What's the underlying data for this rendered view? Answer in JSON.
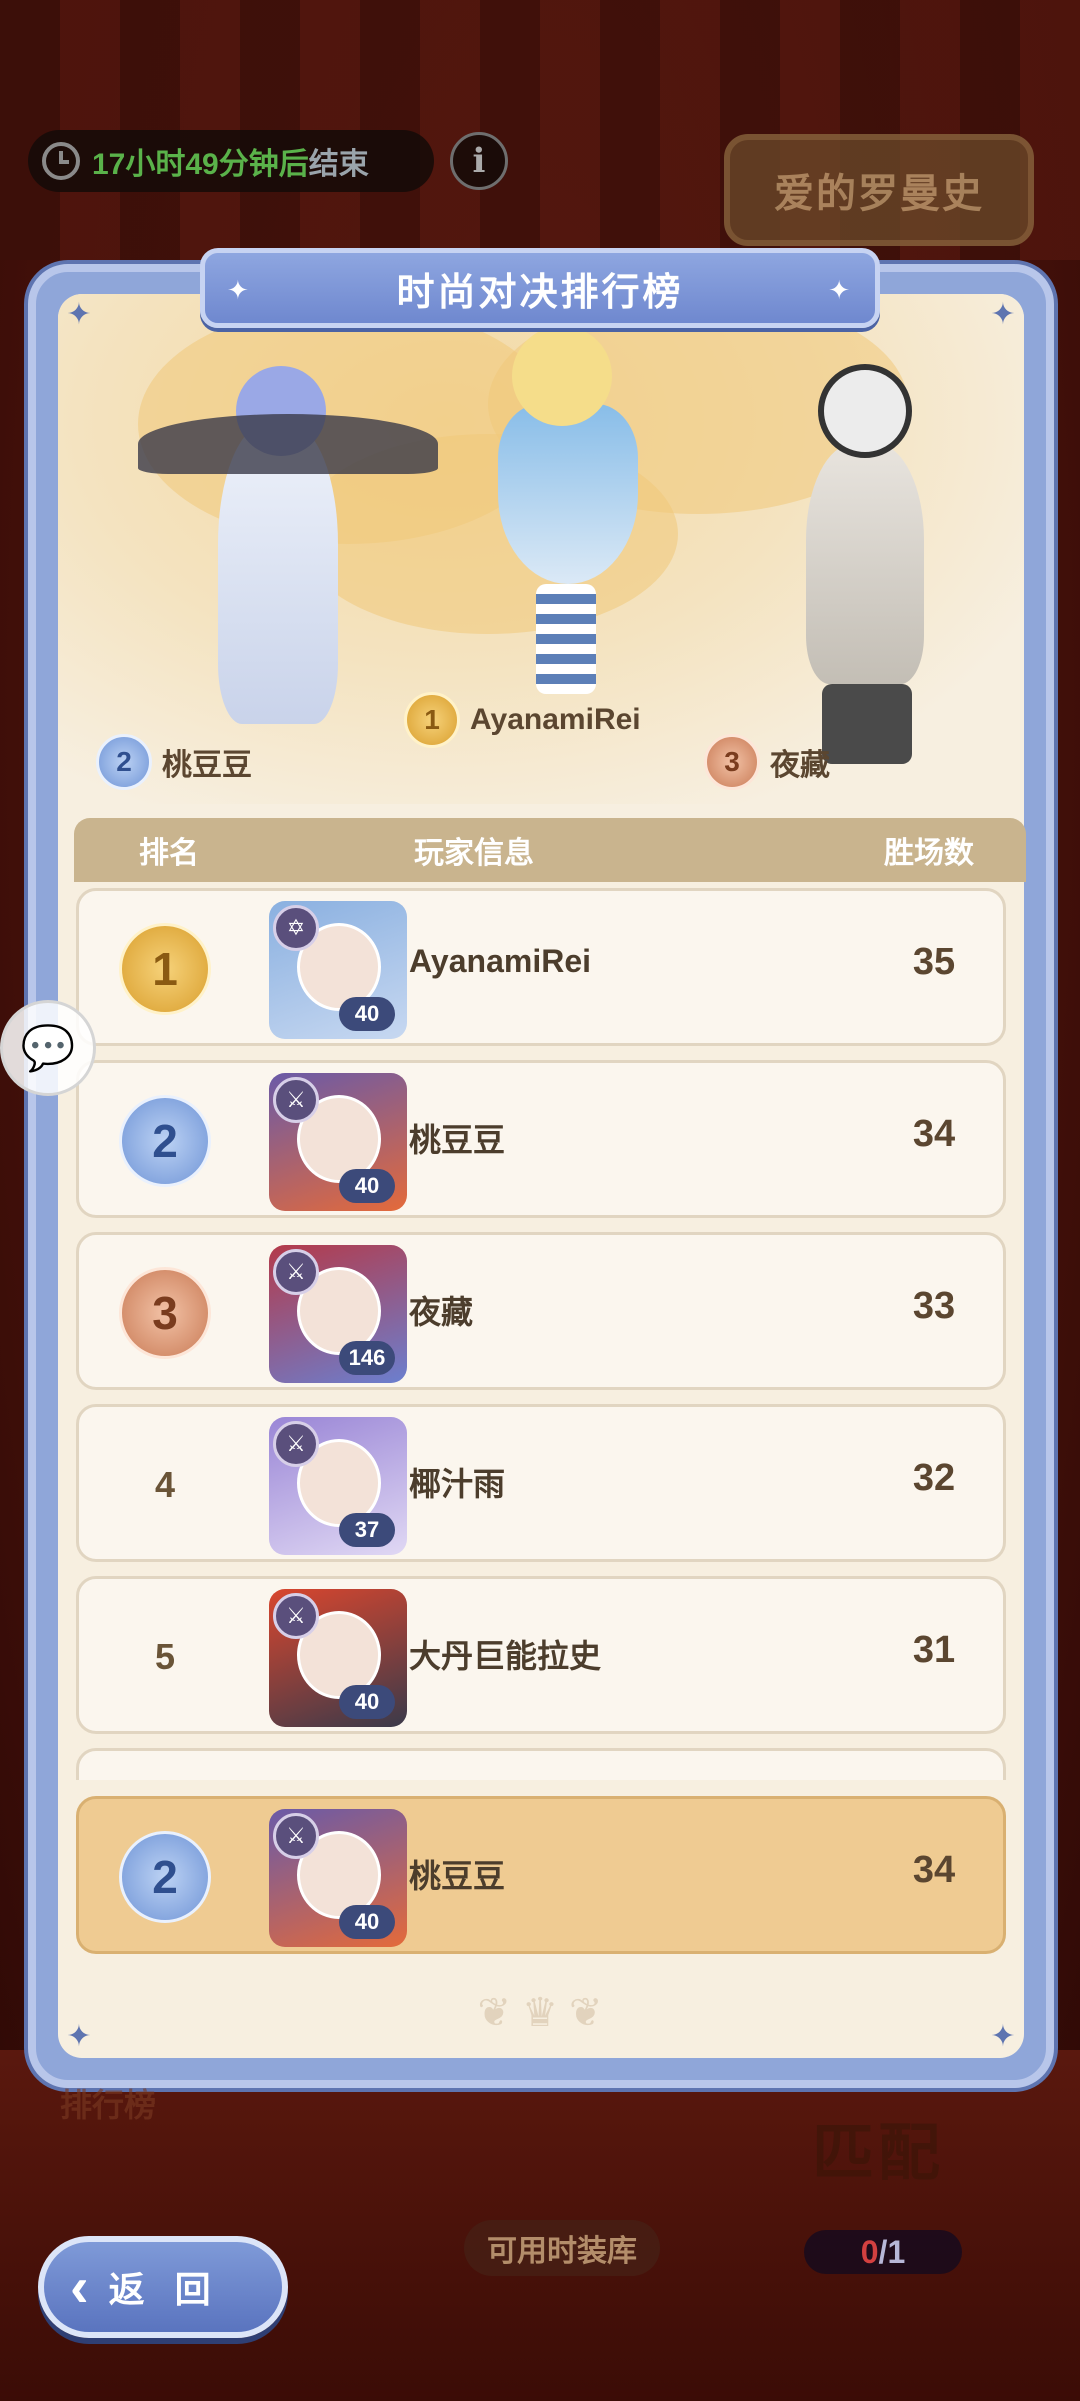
{
  "timer": {
    "remaining": "17小时49分钟后",
    "suffix": "结束"
  },
  "info_label": "i",
  "theme_label": "爱的罗曼史",
  "panel_title": "时尚对决排行榜",
  "podium": [
    {
      "rank": "2",
      "name": "桃豆豆"
    },
    {
      "rank": "1",
      "name": "AyanamiRei"
    },
    {
      "rank": "3",
      "name": "夜藏"
    }
  ],
  "table": {
    "headers": {
      "rank": "排名",
      "info": "玩家信息",
      "wins": "胜场数"
    },
    "rows": [
      {
        "rank": "1",
        "name": "AyanamiRei",
        "level": "40",
        "wins": "35"
      },
      {
        "rank": "2",
        "name": "桃豆豆",
        "level": "40",
        "wins": "34"
      },
      {
        "rank": "3",
        "name": "夜藏",
        "level": "146",
        "wins": "33"
      },
      {
        "rank": "4",
        "name": "椰汁雨",
        "level": "37",
        "wins": "32"
      },
      {
        "rank": "5",
        "name": "大丹巨能拉史",
        "level": "40",
        "wins": "31"
      }
    ]
  },
  "my_row": {
    "rank": "2",
    "name": "桃豆豆",
    "level": "40",
    "wins": "34"
  },
  "bottom": {
    "rank_label": "排行榜",
    "match_label": "匹配",
    "outfit_label": "可用时装库",
    "counter_current": "0",
    "counter_total": "/1",
    "back_label": "返 回"
  },
  "colors": {
    "panel_border": "#8fa6d9",
    "panel_bg": "#f7efe0",
    "header_bg": "#c9b48e",
    "my_row_bg": "#efcb92",
    "timer_green": "#5ab24a"
  }
}
